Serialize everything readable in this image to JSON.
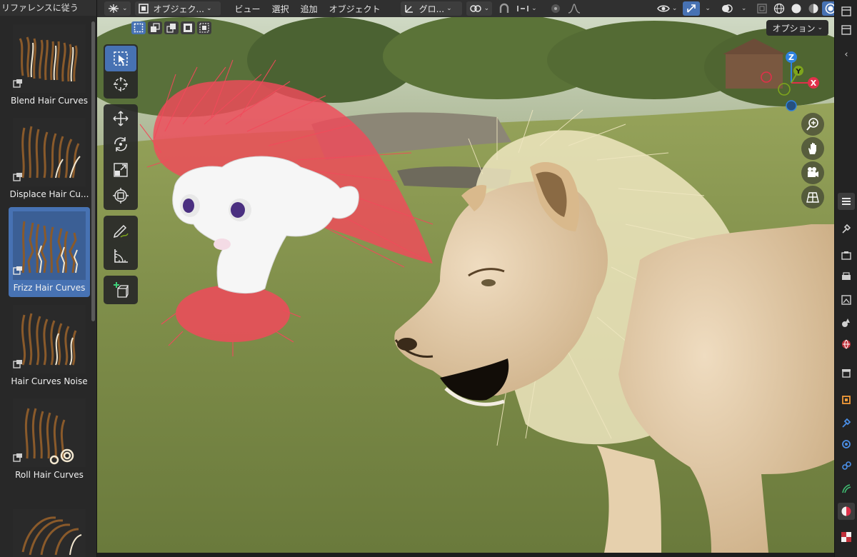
{
  "asset_panel": {
    "header": "リファレンスに従う",
    "items": [
      {
        "label": "Blend Hair Curves",
        "icon": "blend-hair-thumbnail"
      },
      {
        "label": "Displace Hair Cu...",
        "icon": "displace-hair-thumbnail"
      },
      {
        "label": "Frizz Hair Curves",
        "icon": "frizz-hair-thumbnail",
        "selected": true
      },
      {
        "label": "Hair Curves Noise",
        "icon": "noise-hair-thumbnail"
      },
      {
        "label": "Roll Hair Curves",
        "icon": "roll-hair-thumbnail"
      },
      {
        "label": "",
        "icon": "hair-thumbnail"
      }
    ]
  },
  "header": {
    "mode": "オブジェク...",
    "menus": [
      "ビュー",
      "選択",
      "追加",
      "オブジェクト"
    ],
    "transform_orientation": "グロ...",
    "options": "オプション"
  },
  "toolbar": {
    "tools": [
      "select-box",
      "cursor",
      "move",
      "rotate",
      "scale",
      "transform",
      "annotate",
      "measure",
      "add-cube"
    ]
  },
  "gizmo": {
    "x": "X",
    "y": "Y",
    "z": "Z"
  },
  "colors": {
    "accent": "#4772b3",
    "axis_x": "#e0304a",
    "axis_y": "#7ea51c",
    "axis_z": "#2f83e0",
    "hair_red": "#f04a5a",
    "mane": "#efe6bf"
  }
}
